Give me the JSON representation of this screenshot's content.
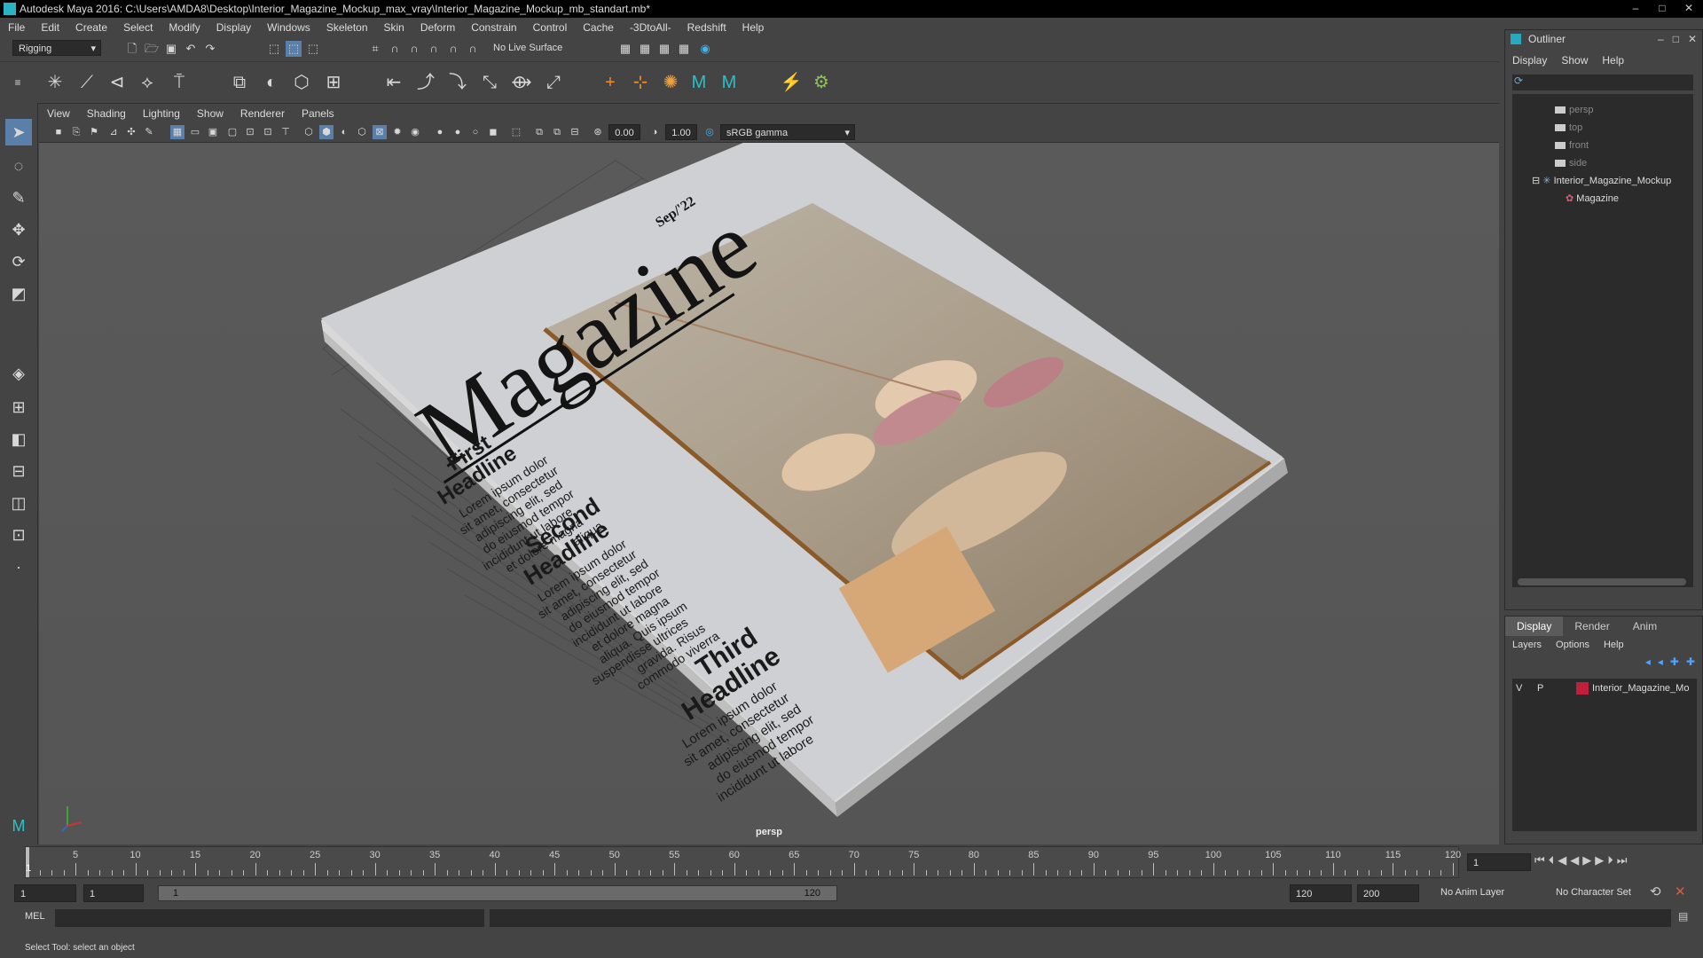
{
  "window": {
    "title": "Autodesk Maya 2016: C:\\Users\\AMDA8\\Desktop\\Interior_Magazine_Mockup_max_vray\\Interior_Magazine_Mockup_mb_standart.mb*",
    "controls": [
      "–",
      "□",
      "✕"
    ]
  },
  "menus": [
    "File",
    "Edit",
    "Create",
    "Select",
    "Modify",
    "Display",
    "Windows",
    "Skeleton",
    "Skin",
    "Deform",
    "Constrain",
    "Control",
    "Cache",
    "-3DtoAll-",
    "Redshift",
    "Help"
  ],
  "status_line": {
    "mode": "Rigging",
    "live_surface": "No Live Surface"
  },
  "viewport": {
    "menus": [
      "View",
      "Shading",
      "Lighting",
      "Show",
      "Renderer",
      "Panels"
    ],
    "exposure": "0.00",
    "gamma": "1.00",
    "color_space": "sRGB gamma",
    "camera_label": "persp"
  },
  "magazine": {
    "date": "Sep/'22",
    "title": "Magazine",
    "headline1": [
      "First",
      "Headline"
    ],
    "body1": [
      "Lorem ipsum dolor",
      "sit amet, consectetur",
      "adipiscing elit, sed",
      "do eiusmod tempor",
      "incididunt ut labore",
      "et dolore magna",
      "aliqua"
    ],
    "headline2": [
      "Second",
      "Headline"
    ],
    "body2": [
      "Lorem ipsum dolor",
      "sit amet, consectetur",
      "adipiscing elit, sed",
      "do eiusmod tempor",
      "incididunt ut labore",
      "et dolore magna",
      "aliqua. Quis ipsum",
      "suspendisse ultrices",
      "gravida. Risus",
      "commodo viverra"
    ],
    "headline3": [
      "Third",
      "Headline"
    ],
    "body3": [
      "Lorem ipsum dolor",
      "sit amet, consectetur",
      "adipiscing elit, sed",
      "do eiusmod tempor",
      "incididunt ut labore"
    ]
  },
  "outliner": {
    "title": "Outliner",
    "menus": [
      "Display",
      "Show",
      "Help"
    ],
    "items": [
      {
        "label": "persp"
      },
      {
        "label": "top"
      },
      {
        "label": "front"
      },
      {
        "label": "side"
      },
      {
        "label": "Interior_Magazine_Mockup"
      },
      {
        "label": "Magazine"
      }
    ]
  },
  "layer_editor": {
    "tabs": [
      "Display",
      "Render",
      "Anim"
    ],
    "menus": [
      "Layers",
      "Options",
      "Help"
    ],
    "layer": {
      "v": "V",
      "p": "P",
      "name": "Interior_Magazine_Mo",
      "color": "#c0203a"
    }
  },
  "timeline": {
    "labels": [
      "5",
      "10",
      "15",
      "20",
      "25",
      "30",
      "35",
      "40",
      "45",
      "50",
      "55",
      "60",
      "65",
      "70",
      "75",
      "80",
      "85",
      "90",
      "95",
      "100",
      "105",
      "110",
      "115",
      "120"
    ],
    "current": "1",
    "current_frame_field": "1"
  },
  "range": {
    "start": "1",
    "anim_start": "1",
    "range_start_label": "1",
    "range_end_label": "120",
    "end": "120",
    "anim_end": "200",
    "anim_layer": "No Anim Layer",
    "character_set": "No Character Set"
  },
  "command_line": {
    "lang": "MEL"
  },
  "help_line": "Select Tool: select an object"
}
